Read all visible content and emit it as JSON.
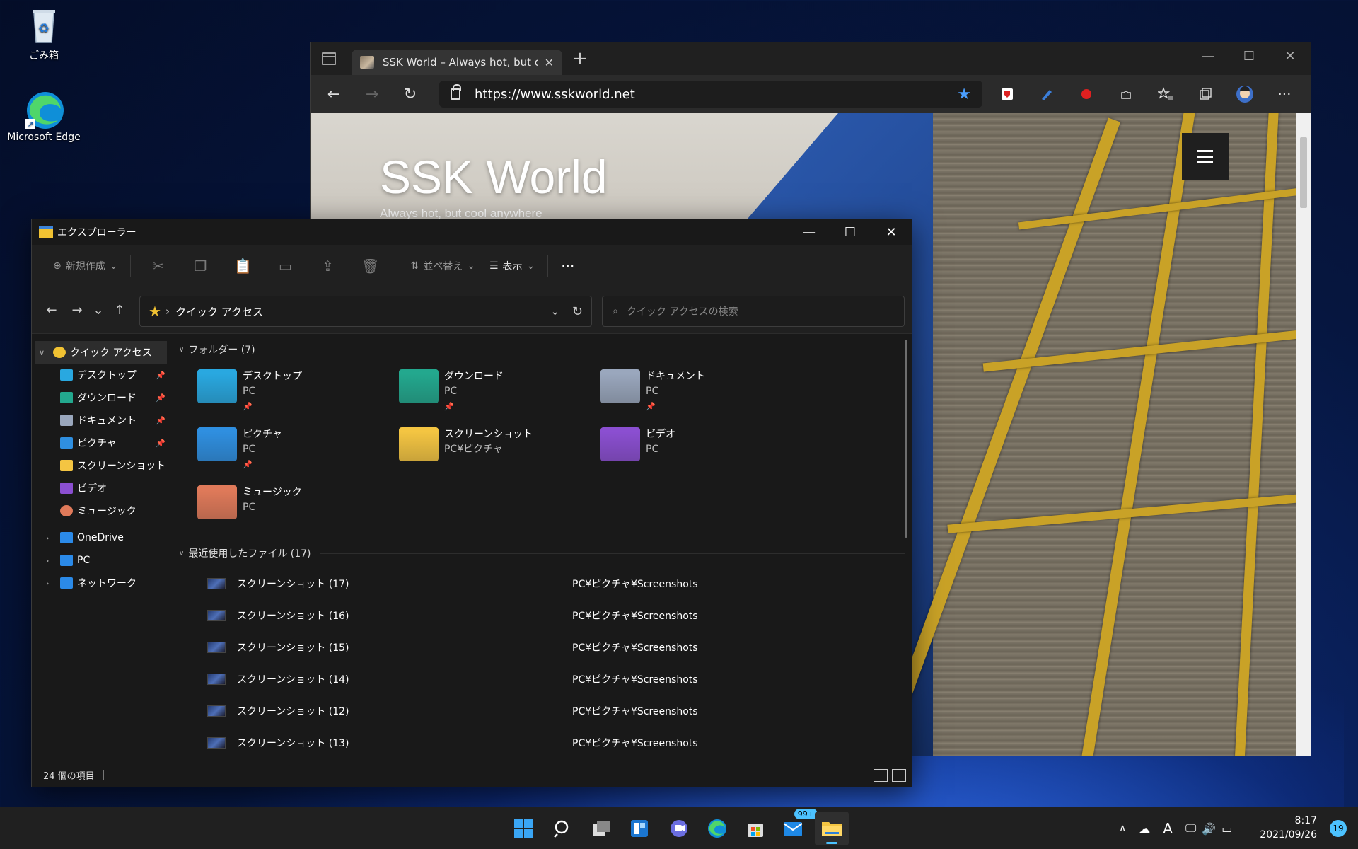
{
  "desktop": {
    "icons": [
      {
        "label": "ごみ箱",
        "icon": "recycle-bin-icon"
      },
      {
        "label": "Microsoft Edge",
        "icon": "edge-icon"
      }
    ]
  },
  "edge": {
    "tab_title": "SSK World – Always hot, but cool anywhere",
    "tab_close": "✕",
    "new_tab": "+",
    "url": "https://www.sskworld.net",
    "site_title": "SSK World",
    "site_tagline": "Always hot, but cool anywhere",
    "controls": {
      "minimize": "—",
      "maximize": "☐",
      "close": "✕"
    },
    "back": "←",
    "forward": "→",
    "refresh": "↻",
    "favorite_star": "★",
    "more": "···"
  },
  "explorer": {
    "window_title": "エクスプローラー",
    "controls": {
      "minimize": "—",
      "maximize": "☐",
      "close": "✕"
    },
    "commands": {
      "new": "新規作成",
      "sort": "並べ替え",
      "view": "表示",
      "more": "···"
    },
    "nav_arrows": {
      "back": "←",
      "forward": "→",
      "recent": "⌄",
      "up": "↑"
    },
    "address": "クイック アクセス",
    "search_placeholder": "クイック アクセスの検索",
    "sidebar": [
      {
        "label": "クイック アクセス",
        "level": 0,
        "expanded": true,
        "selected": true,
        "icon": "star-icon"
      },
      {
        "label": "デスクトップ",
        "level": 1,
        "pinned": true,
        "icon": "desktop-icon"
      },
      {
        "label": "ダウンロード",
        "level": 1,
        "pinned": true,
        "icon": "download-icon"
      },
      {
        "label": "ドキュメント",
        "level": 1,
        "pinned": true,
        "icon": "document-icon"
      },
      {
        "label": "ピクチャ",
        "level": 1,
        "pinned": true,
        "icon": "pictures-icon"
      },
      {
        "label": "スクリーンショット",
        "level": 1,
        "pinned": false,
        "icon": "folder-icon"
      },
      {
        "label": "ビデオ",
        "level": 1,
        "pinned": false,
        "icon": "video-icon"
      },
      {
        "label": "ミュージック",
        "level": 1,
        "pinned": false,
        "icon": "music-icon"
      },
      {
        "label": "OneDrive",
        "level": 0,
        "expanded": false,
        "icon": "onedrive-icon"
      },
      {
        "label": "PC",
        "level": 0,
        "expanded": false,
        "icon": "pc-icon"
      },
      {
        "label": "ネットワーク",
        "level": 0,
        "expanded": false,
        "icon": "network-icon"
      }
    ],
    "folders_header": "フォルダー (7)",
    "folders": [
      {
        "name": "デスクトップ",
        "location": "PC",
        "pinned": true,
        "color": "#29a8e0"
      },
      {
        "name": "ダウンロード",
        "location": "PC",
        "pinned": true,
        "color": "#23a88e"
      },
      {
        "name": "ドキュメント",
        "location": "PC",
        "pinned": true,
        "color": "#9aa7bd"
      },
      {
        "name": "ピクチャ",
        "location": "PC",
        "pinned": true,
        "color": "#2f8fe0"
      },
      {
        "name": "スクリーンショット",
        "location": "PC¥ピクチャ",
        "pinned": false,
        "color": "#f4c542"
      },
      {
        "name": "ビデオ",
        "location": "PC",
        "pinned": false,
        "color": "#8b4fd1"
      },
      {
        "name": "ミュージック",
        "location": "PC",
        "pinned": false,
        "color": "#e07a5a"
      }
    ],
    "recent_header": "最近使用したファイル (17)",
    "recent": [
      {
        "name": "スクリーンショット (17)",
        "path": "PC¥ピクチャ¥Screenshots"
      },
      {
        "name": "スクリーンショット (16)",
        "path": "PC¥ピクチャ¥Screenshots"
      },
      {
        "name": "スクリーンショット (15)",
        "path": "PC¥ピクチャ¥Screenshots"
      },
      {
        "name": "スクリーンショット (14)",
        "path": "PC¥ピクチャ¥Screenshots"
      },
      {
        "name": "スクリーンショット (12)",
        "path": "PC¥ピクチャ¥Screenshots"
      },
      {
        "name": "スクリーンショット (13)",
        "path": "PC¥ピクチャ¥Screenshots"
      }
    ],
    "status": "24 個の項目"
  },
  "taskbar": {
    "mail_badge": "99+",
    "time": "8:17",
    "date": "2021/09/26",
    "notifications": "19",
    "ime": "A"
  }
}
